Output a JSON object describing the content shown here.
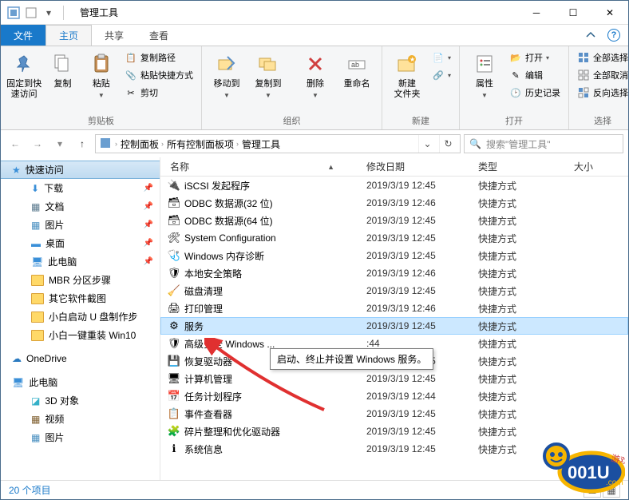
{
  "window": {
    "title": "管理工具"
  },
  "tabs": {
    "file": "文件",
    "home": "主页",
    "share": "共享",
    "view": "查看"
  },
  "ribbon": {
    "pin": {
      "label": "固定到快\n速访问"
    },
    "copy": {
      "label": "复制"
    },
    "paste": {
      "label": "粘贴"
    },
    "copypath": "复制路径",
    "paste_shortcut": "粘贴快捷方式",
    "cut": "剪切",
    "clipboard_group": "剪贴板",
    "moveto": "移动到",
    "copyto": "复制到",
    "delete": "删除",
    "rename": "重命名",
    "organize_group": "组织",
    "newfolder": "新建\n文件夹",
    "new_group": "新建",
    "properties": "属性",
    "open": "打开",
    "edit": "编辑",
    "history": "历史记录",
    "open_group": "打开",
    "select_all": "全部选择",
    "select_none": "全部取消",
    "invert": "反向选择",
    "select_group": "选择"
  },
  "breadcrumb": {
    "p1": "控制面板",
    "p2": "所有控制面板项",
    "p3": "管理工具"
  },
  "search": {
    "placeholder": "搜索\"管理工具\""
  },
  "nav": {
    "quick": "快速访问",
    "downloads": "下载",
    "docs": "文档",
    "pics": "图片",
    "desktop": "桌面",
    "thispc": "此电脑",
    "mbr": "MBR 分区步骤",
    "other_sw": "其它软件截图",
    "xb_u": "小白启动 U 盘制作步",
    "xb_win10": "小白一键重装 Win10",
    "onedrive": "OneDrive",
    "thispc2": "此电脑",
    "obj3d": "3D 对象",
    "video": "视频",
    "pics2": "图片"
  },
  "columns": {
    "name": "名称",
    "date": "修改日期",
    "type": "类型",
    "size": "大小"
  },
  "files": [
    {
      "name": "iSCSI 发起程序",
      "date": "2019/3/19 12:45",
      "type": "快捷方式"
    },
    {
      "name": "ODBC 数据源(32 位)",
      "date": "2019/3/19 12:46",
      "type": "快捷方式"
    },
    {
      "name": "ODBC 数据源(64 位)",
      "date": "2019/3/19 12:45",
      "type": "快捷方式"
    },
    {
      "name": "System Configuration",
      "date": "2019/3/19 12:45",
      "type": "快捷方式"
    },
    {
      "name": "Windows 内存诊断",
      "date": "2019/3/19 12:45",
      "type": "快捷方式"
    },
    {
      "name": "本地安全策略",
      "date": "2019/3/19 12:46",
      "type": "快捷方式"
    },
    {
      "name": "磁盘清理",
      "date": "2019/3/19 12:45",
      "type": "快捷方式"
    },
    {
      "name": "打印管理",
      "date": "2019/3/19 12:46",
      "type": "快捷方式"
    },
    {
      "name": "服务",
      "date": "2019/3/19 12:45",
      "type": "快捷方式",
      "selected": true
    },
    {
      "name": "高级安全 Windows ...",
      "date": ":44",
      "type": "快捷方式"
    },
    {
      "name": "恢复驱动器",
      "date": "2019/3/19 12:45",
      "type": "快捷方式"
    },
    {
      "name": "计算机管理",
      "date": "2019/3/19 12:45",
      "type": "快捷方式"
    },
    {
      "name": "任务计划程序",
      "date": "2019/3/19 12:44",
      "type": "快捷方式"
    },
    {
      "name": "事件查看器",
      "date": "2019/3/19 12:45",
      "type": "快捷方式"
    },
    {
      "name": "碎片整理和优化驱动器",
      "date": "2019/3/19 12:45",
      "type": "快捷方式"
    },
    {
      "name": "系统信息",
      "date": "2019/3/19 12:45",
      "type": "快捷方式"
    }
  ],
  "tooltip": "启动、终止并设置 Windows 服务。",
  "status": {
    "count": "20 个项目"
  }
}
